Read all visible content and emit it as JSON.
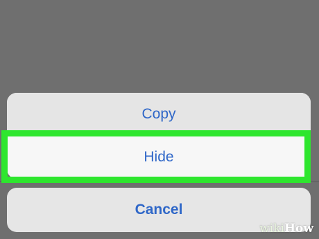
{
  "action_sheet": {
    "items": [
      {
        "label": "Copy"
      },
      {
        "label": "Hide"
      }
    ],
    "cancel_label": "Cancel"
  },
  "highlight": {
    "target": "Hide",
    "color": "#2ee62e"
  },
  "watermark": {
    "part1": "wiki",
    "part2": "How"
  },
  "colors": {
    "accent": "#2f67c8",
    "backdrop": "#6f6f6f"
  }
}
